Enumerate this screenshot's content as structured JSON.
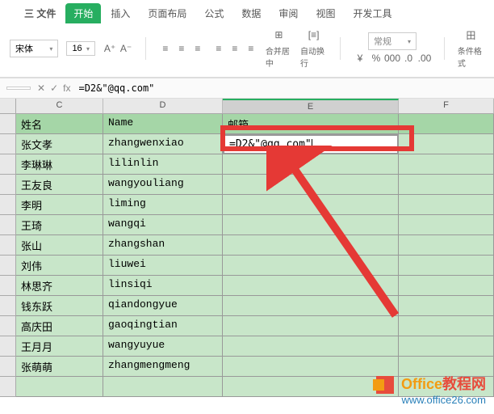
{
  "tabs": {
    "file": "三 文件",
    "start": "开始",
    "insert": "插入",
    "layout": "页面布局",
    "formula": "公式",
    "data": "数据",
    "review": "审阅",
    "view": "视图",
    "dev": "开发工具"
  },
  "toolbar": {
    "font": "宋体",
    "size": "16",
    "merge": "合并居中",
    "wrap": "自动换行",
    "numfmt": "常规",
    "condfmt": "条件格式"
  },
  "formula_bar": {
    "fx": "fx",
    "value": "=D2&\"@qq.com\""
  },
  "columns": {
    "c": "C",
    "d": "D",
    "e": "E",
    "f": "F"
  },
  "headers": {
    "name_cn": "姓名",
    "name_en": "Name",
    "email": "邮箱"
  },
  "editing_cell": "=D2&\"@qq.com\"",
  "rows": [
    {
      "cn": "张文孝",
      "en": "zhangwenxiao"
    },
    {
      "cn": "李琳琳",
      "en": "lilinlin"
    },
    {
      "cn": "王友良",
      "en": "wangyouliang"
    },
    {
      "cn": "李明",
      "en": "liming"
    },
    {
      "cn": "王琦",
      "en": "wangqi"
    },
    {
      "cn": "张山",
      "en": "zhangshan"
    },
    {
      "cn": "刘伟",
      "en": "liuwei"
    },
    {
      "cn": "林思齐",
      "en": "linsiqi"
    },
    {
      "cn": "钱东跃",
      "en": "qiandongyue"
    },
    {
      "cn": "高庆田",
      "en": "gaoqingtian"
    },
    {
      "cn": "王月月",
      "en": "wangyuyue"
    },
    {
      "cn": "张萌萌",
      "en": "zhangmengmeng"
    }
  ],
  "watermark": {
    "brand_en": "Office",
    "brand_cn": "教程网",
    "url": "www.office26.com"
  }
}
